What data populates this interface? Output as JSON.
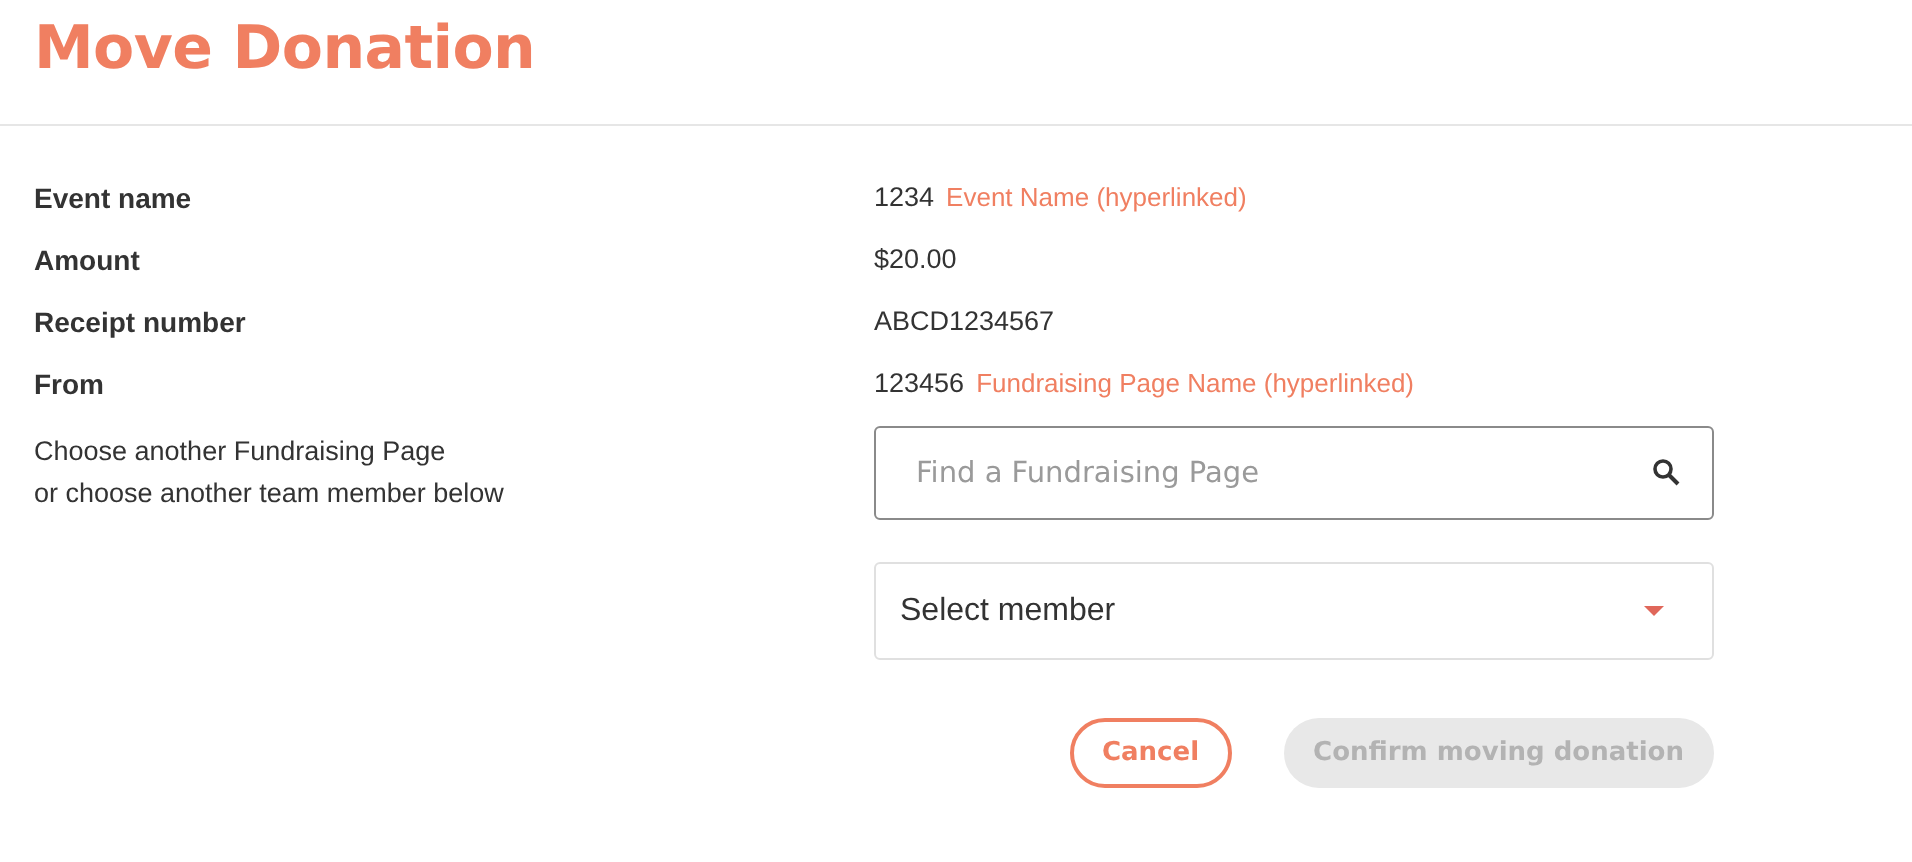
{
  "title": "Move Donation",
  "details": [
    {
      "label": "Event name",
      "kind": "link",
      "id": "1234",
      "link": "Event Name (hyperlinked)"
    },
    {
      "label": "Amount",
      "kind": "text",
      "value": "$20.00"
    },
    {
      "label": "Receipt number",
      "kind": "text",
      "value": "ABCD1234567"
    },
    {
      "label": "From",
      "kind": "link",
      "id": "123456",
      "link": "Fundraising Page Name (hyperlinked)"
    }
  ],
  "choose_text": [
    "Choose another Fundraising Page",
    "or choose another team member below"
  ],
  "search": {
    "placeholder": "Find a Fundraising Page"
  },
  "member_select": {
    "value": "Select member"
  },
  "buttons": [
    {
      "label": "Cancel",
      "kind": "outline",
      "disabled": false
    },
    {
      "label": "Confirm moving donation",
      "kind": "primary",
      "disabled": true
    }
  ]
}
